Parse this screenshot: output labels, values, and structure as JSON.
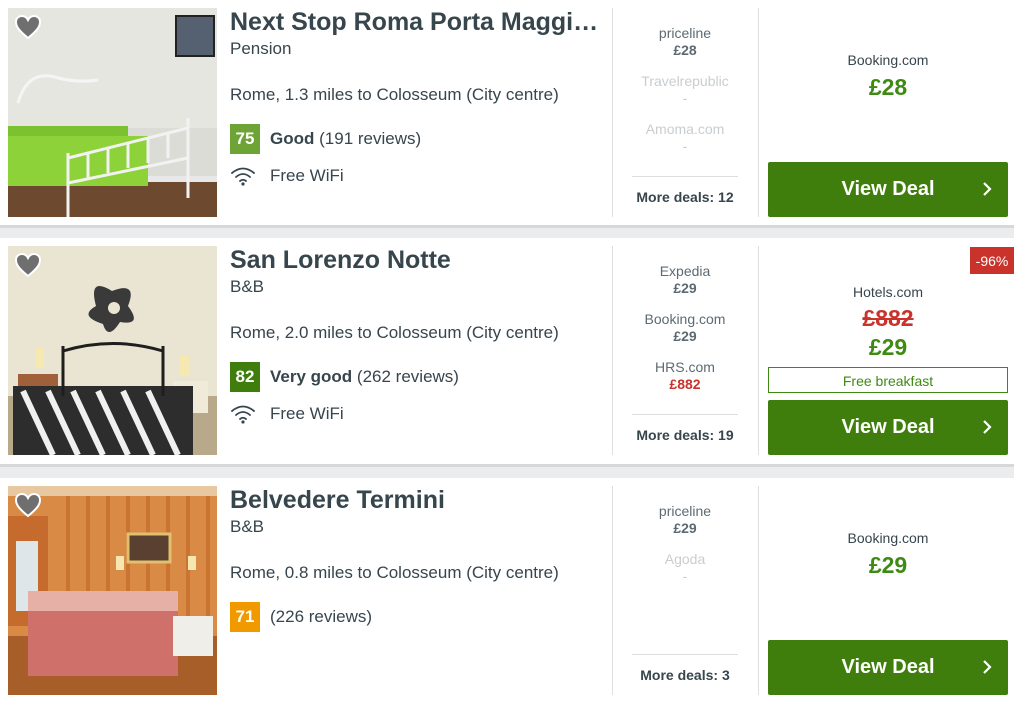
{
  "listings": [
    {
      "name": "Next Stop Roma Porta Maggiore",
      "type": "Pension",
      "location": "Rome, 1.3 miles to Colosseum (City centre)",
      "score": "75",
      "score_color": "#6da435",
      "rating_label": "Good",
      "reviews": "(191 reviews)",
      "amenity": "Free WiFi",
      "deals": [
        {
          "provider": "priceline",
          "price": "£28"
        },
        {
          "provider": "Travelrepublic",
          "price": "-"
        },
        {
          "provider": "Amoma.com",
          "price": "-"
        }
      ],
      "more_deals": "More deals: 12",
      "best_provider": "Booking.com",
      "best_price": "£28",
      "button": "View Deal"
    },
    {
      "name": "San Lorenzo Notte",
      "type": "B&B",
      "location": "Rome, 2.0 miles to Colosseum (City centre)",
      "score": "82",
      "score_color": "#3f7e0c",
      "rating_label": "Very good",
      "reviews": "(262 reviews)",
      "amenity": "Free WiFi",
      "deals": [
        {
          "provider": "Expedia",
          "price": "£29"
        },
        {
          "provider": "Booking.com",
          "price": "£29"
        },
        {
          "provider": "HRS.com",
          "price": "£882"
        }
      ],
      "more_deals": "More deals: 19",
      "discount": "-96%",
      "best_provider": "Hotels.com",
      "old_price": "£882",
      "best_price": "£29",
      "extra": "Free breakfast",
      "button": "View Deal"
    },
    {
      "name": "Belvedere Termini",
      "type": "B&B",
      "location": "Rome, 0.8 miles to Colosseum (City centre)",
      "score": "71",
      "score_color": "#f09a00",
      "rating_label": "",
      "reviews": "(226 reviews)",
      "deals": [
        {
          "provider": "priceline",
          "price": "£29"
        },
        {
          "provider": "Agoda",
          "price": "-"
        }
      ],
      "more_deals": "More deals: 3",
      "best_provider": "Booking.com",
      "best_price": "£29",
      "button": "View Deal"
    }
  ]
}
